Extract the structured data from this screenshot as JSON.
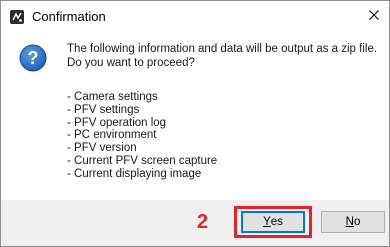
{
  "window": {
    "title": "Confirmation",
    "close_icon": "close-icon",
    "app_icon": "app-icon"
  },
  "message": {
    "icon": "question-icon",
    "line1": "The following information and data will be output as a zip file.",
    "line2": "Do you want to proceed?"
  },
  "items": [
    "- Camera settings",
    "- PFV settings",
    "- PFV operation log",
    "- PC environment",
    "- PFV version",
    "- Current PFV screen capture",
    "- Current displaying image"
  ],
  "annotation": {
    "step": "2",
    "color": "#e8212b"
  },
  "buttons": {
    "yes": {
      "mnemonic": "Y",
      "rest": "es"
    },
    "no": {
      "mnemonic": "N",
      "rest": "o"
    }
  },
  "colors": {
    "accent": "#0078d7",
    "footer_bg": "#f0f0f0",
    "question_icon": "#1f5fb4"
  }
}
